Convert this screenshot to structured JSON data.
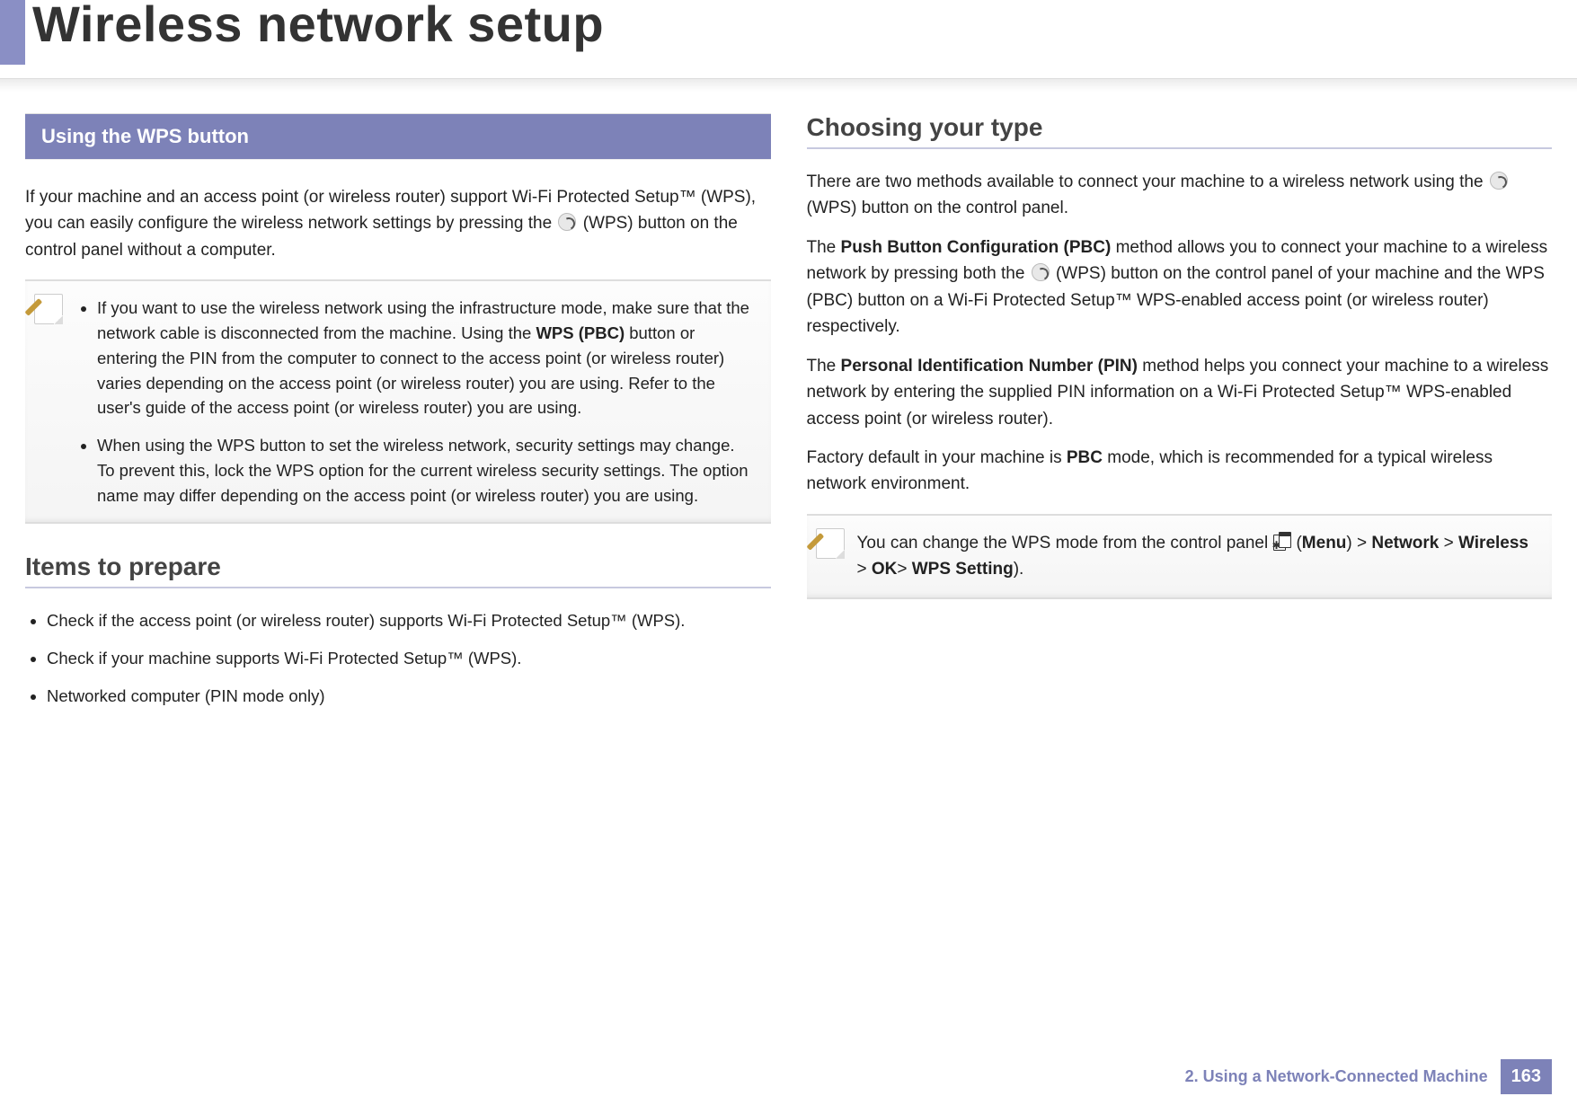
{
  "header": {
    "title": "Wireless network setup"
  },
  "left": {
    "section_box": "Using the WPS button",
    "intro": "If your machine and an access point (or wireless router) support Wi-Fi Protected Setup™ (WPS), you can easily configure the wireless network settings by pressing the ",
    "intro_after_icon": " (WPS) button on the control panel without a computer.",
    "note1_a": "If you want to use the wireless network using the infrastructure mode, make sure that the network cable is disconnected from the machine. Using the ",
    "note1_bold": "WPS (PBC)",
    "note1_b": " button or entering the PIN from the computer to connect to the access point (or wireless router) varies depending on the access point (or wireless router) you are using. Refer to the user's guide of the access point (or wireless router) you are using.",
    "note2": "When using the WPS button to set the wireless network, security settings may change. To prevent this, lock the WPS option for the current wireless security settings. The option name may differ depending on the access point (or wireless router) you are using.",
    "prepare_title": "Items to prepare",
    "prepare_items": [
      "Check if the access point (or wireless router) supports Wi-Fi Protected Setup™ (WPS).",
      "Check if your machine supports Wi-Fi Protected Setup™ (WPS).",
      "Networked computer (PIN mode only)"
    ]
  },
  "right": {
    "title": "Choosing your type",
    "p1a": "There are two methods available to connect your machine to a wireless network using the ",
    "p1b": " (WPS) button on the control panel.",
    "p2a": "The ",
    "p2bold": "Push Button Configuration (PBC)",
    "p2b": " method allows you to connect your machine to a wireless network by pressing both the ",
    "p2c": " (WPS) button on the control panel of your machine and the WPS (PBC) button on a Wi-Fi Protected Setup™ WPS-enabled access point (or wireless router) respectively.",
    "p3a": "The ",
    "p3bold": "Personal Identification Number (PIN)",
    "p3b": " method helps you connect your machine to a wireless network by entering the supplied PIN information on a Wi-Fi Protected Setup™ WPS-enabled access point (or wireless router).",
    "p4a": "Factory default in your machine is ",
    "p4bold": "PBC",
    "p4b": " mode, which is recommended for a typical wireless network environment.",
    "note_a": "You can change the WPS mode from the control panel ",
    "note_menu": "Menu",
    "note_gt1": " > ",
    "note_network": "Network",
    "note_gt2": " > ",
    "note_wireless": "Wireless",
    "note_gt3": " > ",
    "note_ok": "OK",
    "note_gt4": "> ",
    "note_wps": "WPS Setting",
    "note_end": ")."
  },
  "footer": {
    "chapter": "2.  Using a Network-Connected Machine",
    "page": "163"
  }
}
